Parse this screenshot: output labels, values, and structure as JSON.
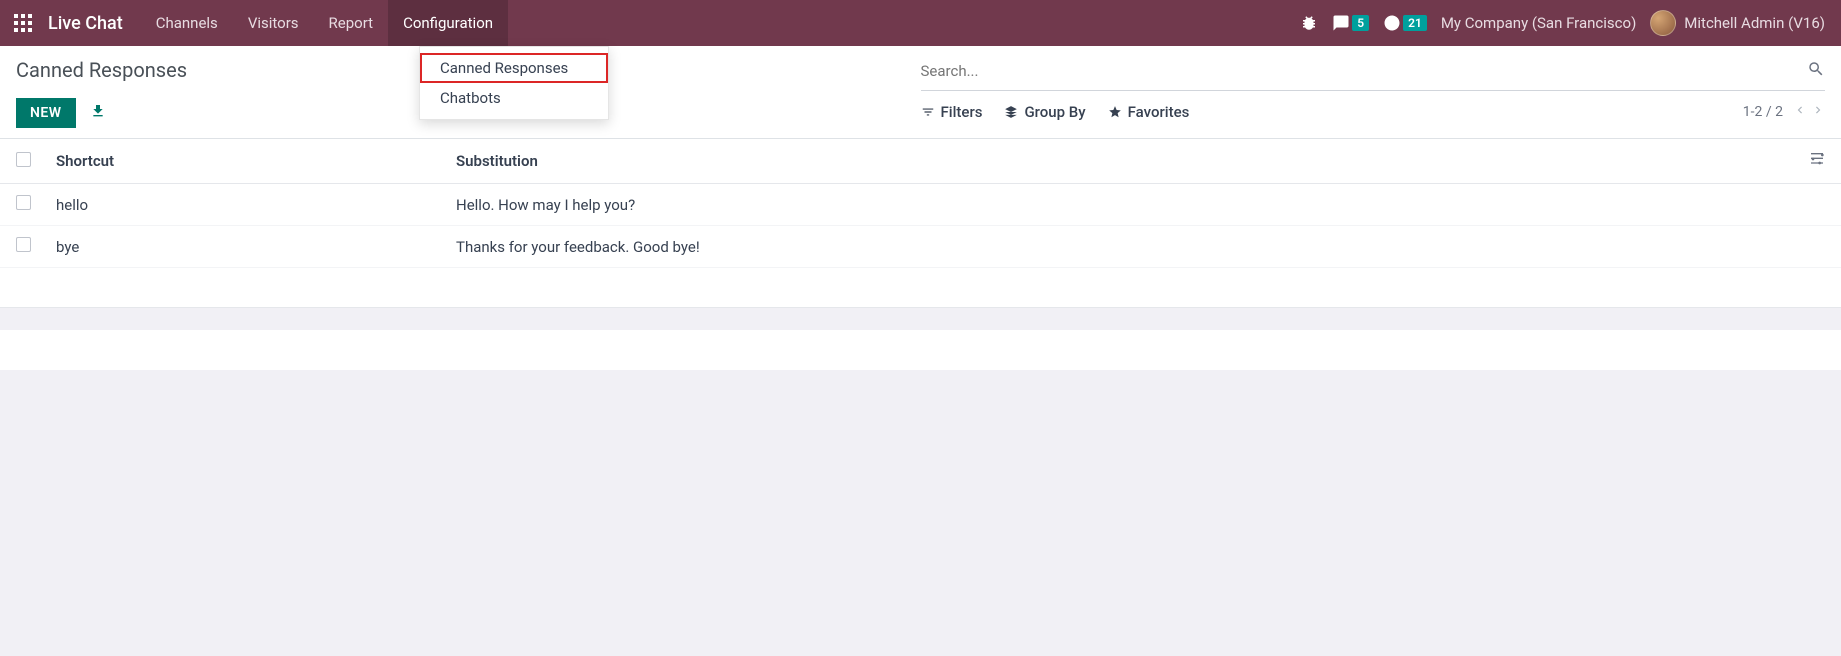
{
  "navbar": {
    "brand": "Live Chat",
    "items": [
      "Channels",
      "Visitors",
      "Report",
      "Configuration"
    ],
    "active_index": 3,
    "messages_badge": "5",
    "activities_badge": "21",
    "company": "My Company (San Francisco)",
    "user": "Mitchell Admin (V16)"
  },
  "dropdown": {
    "items": [
      "Canned Responses",
      "Chatbots"
    ],
    "highlighted_index": 0
  },
  "page": {
    "title": "Canned Responses",
    "new_button": "NEW"
  },
  "search": {
    "placeholder": "Search...",
    "filters_label": "Filters",
    "groupby_label": "Group By",
    "favorites_label": "Favorites",
    "pager": "1-2 / 2"
  },
  "table": {
    "headers": {
      "shortcut": "Shortcut",
      "substitution": "Substitution"
    },
    "rows": [
      {
        "shortcut": "hello",
        "substitution": "Hello. How may I help you?"
      },
      {
        "shortcut": "bye",
        "substitution": "Thanks for your feedback. Good bye!"
      }
    ]
  }
}
